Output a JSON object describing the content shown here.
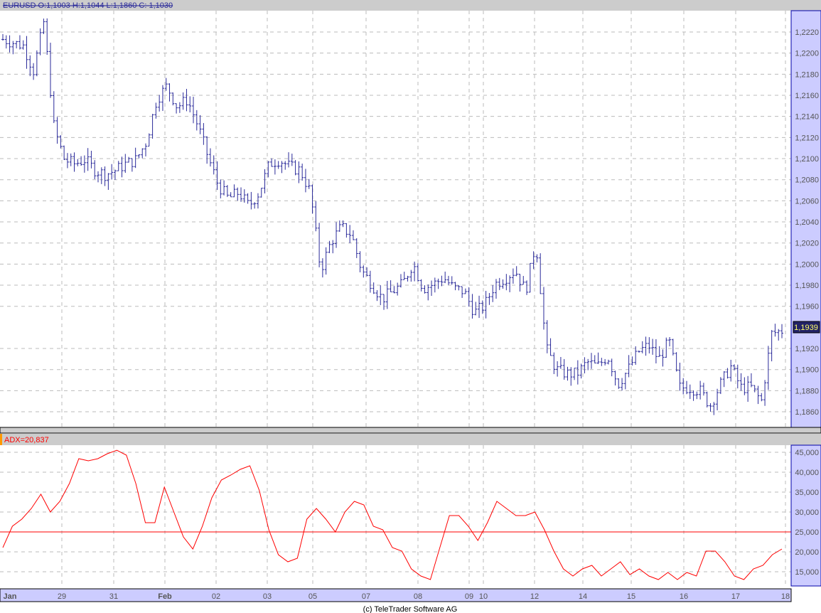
{
  "header": {
    "title": "EURUSD O:1,1003 H:1,1044 L:1,1860 C: 1,1030"
  },
  "footer": {
    "copyright": "(c) TeleTrader Software AG"
  },
  "colors": {
    "price": "#2a2a9a",
    "adx": "#ff0000",
    "axis_bg": "#ccccff",
    "panel_header": "#cccccc"
  },
  "chart_data": [
    {
      "type": "ohlc",
      "title": "EURUSD",
      "last_value_label": "1,1939",
      "ylim": [
        1.185,
        1.224
      ],
      "y_ticks": [
        "1,2220",
        "1,2200",
        "1,2180",
        "1,2160",
        "1,2140",
        "1,2120",
        "1,2100",
        "1,2080",
        "1,2060",
        "1,2040",
        "1,2020",
        "1,2000",
        "1,1980",
        "1,1960",
        "1,1920",
        "1,1900",
        "1,1880",
        "1,1860"
      ],
      "y_tick_values": [
        1.222,
        1.22,
        1.218,
        1.216,
        1.214,
        1.212,
        1.21,
        1.208,
        1.206,
        1.204,
        1.202,
        1.2,
        1.198,
        1.196,
        1.192,
        1.19,
        1.188,
        1.186
      ],
      "close_path": [
        1.2213,
        1.221,
        1.2207,
        1.2183,
        1.223,
        1.2129,
        1.2099,
        1.2095,
        1.2099,
        1.2089,
        1.2085,
        1.2089,
        1.2095,
        1.2099,
        1.2116,
        1.2156,
        1.2169,
        1.2149,
        1.2156,
        1.2132,
        1.2102,
        1.2075,
        1.2062,
        1.2068,
        1.2055,
        1.2068,
        1.2095,
        1.2099,
        1.2092,
        1.2089,
        1.2068,
        1.1994,
        1.2021,
        1.2035,
        1.2028,
        1.1994,
        1.1981,
        1.1967,
        1.1974,
        1.1981,
        1.2001,
        1.1977,
        1.1981,
        1.1987,
        1.1977,
        1.1974,
        1.1954,
        1.1961,
        1.1981,
        1.1987,
        1.1994,
        1.1974,
        1.2021,
        1.192,
        1.19,
        1.1896,
        1.1896,
        1.1907,
        1.1903,
        1.1913,
        1.1886,
        1.19,
        1.1917,
        1.1923,
        1.191,
        1.1927,
        1.1883,
        1.1883,
        1.188,
        1.1866,
        1.1886,
        1.1903,
        1.1883,
        1.1883,
        1.187,
        1.1934,
        1.1937
      ]
    },
    {
      "type": "line",
      "title": "ADX",
      "legend": "ADX=20,837",
      "ylim": [
        12000,
        47000
      ],
      "reference_line": 25000,
      "y_ticks": [
        "45,000",
        "40,000",
        "35,000",
        "30,000",
        "25,000",
        "20,000",
        "15,000"
      ],
      "y_tick_values": [
        45000,
        40000,
        35000,
        30000,
        25000,
        20000,
        15000
      ],
      "values": [
        21070,
        26430,
        28210,
        30890,
        34460,
        30000,
        32680,
        37140,
        43390,
        42860,
        43390,
        44640,
        45500,
        44290,
        37140,
        27320,
        27320,
        36250,
        30000,
        23750,
        20710,
        26430,
        33570,
        38040,
        39290,
        40710,
        41610,
        35360,
        25540,
        19290,
        17500,
        18390,
        28210,
        30890,
        28210,
        25000,
        30000,
        32680,
        31790,
        26430,
        25540,
        21070,
        20180,
        15710,
        13930,
        13040,
        21070,
        29110,
        29110,
        26430,
        22860,
        27320,
        32680,
        30890,
        29110,
        29110,
        30000,
        25540,
        20180,
        15710,
        13930,
        15710,
        16610,
        13930,
        15710,
        17500,
        14290,
        15710,
        13930,
        13040,
        14820,
        13040,
        14820,
        13930,
        20180,
        20180,
        17500,
        13930,
        13040,
        15710,
        16610,
        19290,
        20710
      ],
      "x_ticks": [
        "Jan",
        "29",
        "31",
        "Feb",
        "02",
        "03",
        "05",
        "07",
        "08",
        "09",
        "10",
        "12",
        "14",
        "15",
        "16",
        "17",
        "18"
      ]
    }
  ]
}
